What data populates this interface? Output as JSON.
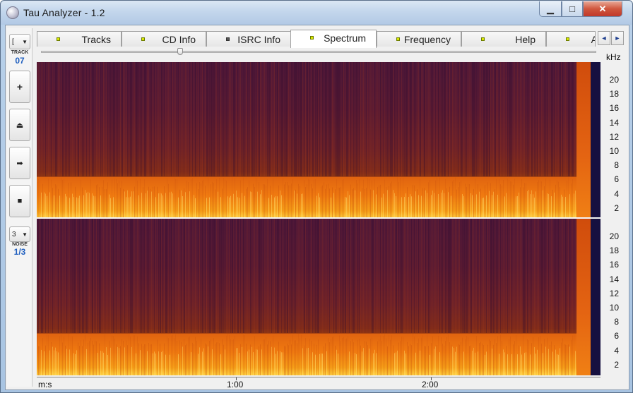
{
  "window": {
    "title": "Tau Analyzer - 1.2",
    "minimize_glyph": "▁",
    "maximize_glyph": "□",
    "close_glyph": "✕"
  },
  "sidebar": {
    "track_dropdown_value": "[",
    "track_caption": "TRACK",
    "track_number": "07",
    "add_glyph": "+",
    "eject_glyph": "⏏",
    "play_glyph": "➡",
    "stop_glyph": "■",
    "mode_dropdown_value": "3",
    "mode_caption": "NOISE",
    "mode_value": "1/3"
  },
  "tabs": [
    {
      "label": "Tracks",
      "led": "yellow"
    },
    {
      "label": "CD Info",
      "led": "yellow"
    },
    {
      "label": "ISRC Info",
      "led": "grey"
    },
    {
      "label": "Spectrum",
      "led": "yellow",
      "active": true
    },
    {
      "label": "Frequency",
      "led": "yellow"
    },
    {
      "label": "Help",
      "led": "yellow"
    },
    {
      "label": "A",
      "led": "yellow"
    }
  ],
  "tab_scroll": {
    "left": "◄",
    "right": "►"
  },
  "spectrum": {
    "unit_label": "kHz",
    "y_ticks": [
      "20",
      "18",
      "16",
      "14",
      "12",
      "10",
      "8",
      "6",
      "4",
      "2"
    ],
    "time_axis": {
      "unit_label": "m:s",
      "ticks": [
        "1:00",
        "2:00"
      ]
    },
    "colors": {
      "low": "#501838",
      "mid": "#8a3314",
      "high": "#f7a018",
      "peak": "#ffd040",
      "background": "#161040"
    }
  }
}
